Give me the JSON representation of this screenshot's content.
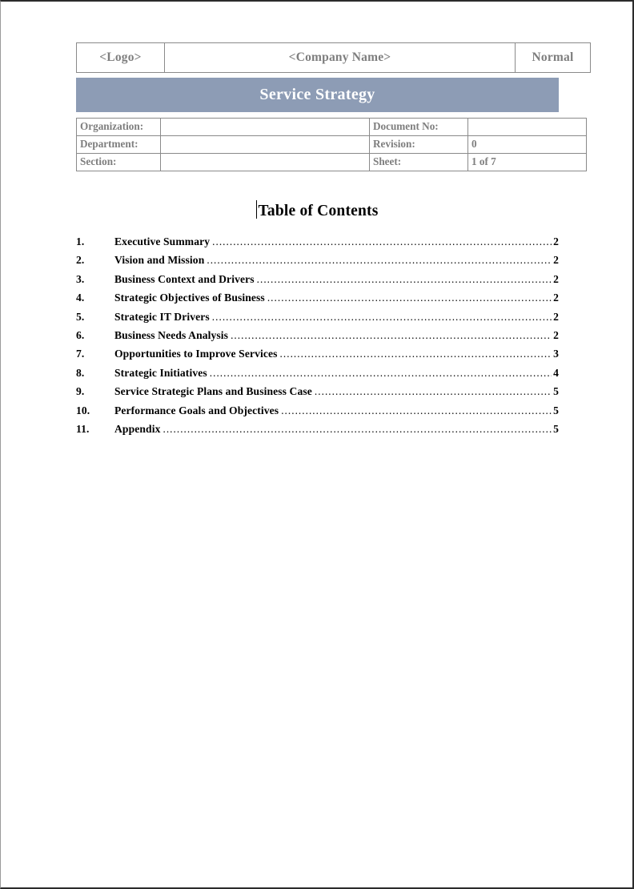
{
  "header": {
    "logo_label": "<Logo>",
    "company_label": "<Company Name>",
    "status_label": "Normal"
  },
  "banner": {
    "title": "Service Strategy",
    "color": "#8d9cb5"
  },
  "metadata": {
    "rows": [
      {
        "label": "Organization:",
        "value": "",
        "label2": "Document No:",
        "value2": ""
      },
      {
        "label": "Department:",
        "value": "",
        "label2": "Revision:",
        "value2": "0"
      },
      {
        "label": "Section:",
        "value": "",
        "label2": "Sheet:",
        "value2": "1 of 7"
      }
    ]
  },
  "toc": {
    "heading": "Table of Contents",
    "entries": [
      {
        "num": "1.",
        "label": "Executive Summary",
        "page": "2"
      },
      {
        "num": "2.",
        "label": "Vision and Mission",
        "page": "2"
      },
      {
        "num": "3.",
        "label": "Business Context and Drivers",
        "page": "2"
      },
      {
        "num": "4.",
        "label": "Strategic Objectives of Business",
        "page": "2"
      },
      {
        "num": "5.",
        "label": "Strategic IT Drivers",
        "page": "2"
      },
      {
        "num": "6.",
        "label": "Business Needs Analysis",
        "page": "2"
      },
      {
        "num": "7.",
        "label": "Opportunities to Improve Services",
        "page": "3"
      },
      {
        "num": "8.",
        "label": "Strategic Initiatives",
        "page": "4"
      },
      {
        "num": "9.",
        "label": "Service Strategic Plans and Business Case",
        "page": "5"
      },
      {
        "num": "10.",
        "label": "Performance Goals and Objectives",
        "page": "5"
      },
      {
        "num": "11.",
        "label": "Appendix",
        "page": "5"
      }
    ]
  }
}
